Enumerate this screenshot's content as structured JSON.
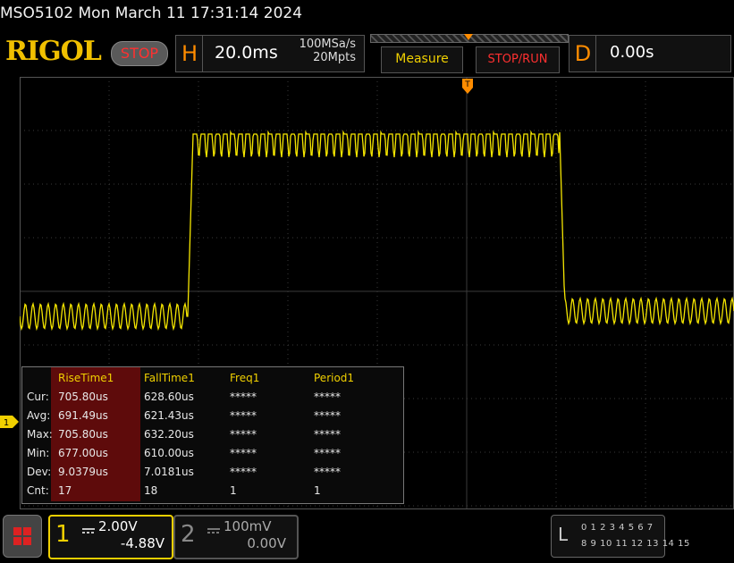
{
  "title": "MSO5102  Mon March 11 17:31:14 2024",
  "brand": "RIGOL",
  "run_state": "STOP",
  "horizontal": {
    "label": "H",
    "timebase": "20.0ms",
    "sample_rate": "100MSa/s",
    "memory_depth": "20Mpts"
  },
  "buttons": {
    "measure": "Measure",
    "stop_run": "STOP/RUN"
  },
  "delay": {
    "label": "D",
    "value": "0.00s"
  },
  "measurements": {
    "headers": [
      "RiseTime1",
      "FallTime1",
      "Freq1",
      "Period1"
    ],
    "rows": [
      {
        "label": "Cur:",
        "values": [
          "705.80us",
          "628.60us",
          "*****",
          "*****"
        ]
      },
      {
        "label": "Avg:",
        "values": [
          "691.49us",
          "621.43us",
          "*****",
          "*****"
        ]
      },
      {
        "label": "Max:",
        "values": [
          "705.80us",
          "632.20us",
          "*****",
          "*****"
        ]
      },
      {
        "label": "Min:",
        "values": [
          "677.00us",
          "610.00us",
          "*****",
          "*****"
        ]
      },
      {
        "label": "Dev:",
        "values": [
          "9.0379us",
          "7.0181us",
          "*****",
          "*****"
        ]
      },
      {
        "label": "Cnt:",
        "values": [
          "17",
          "18",
          "1",
          "1"
        ]
      }
    ]
  },
  "channel1": {
    "number": "1",
    "scale": "2.00V",
    "offset": "-4.88V",
    "color": "#f0d000"
  },
  "channel2": {
    "number": "2",
    "scale": "100mV",
    "offset": "0.00V",
    "color": "#888888"
  },
  "ch1_marker": "1",
  "logic": {
    "label": "L",
    "row1": "0 1 2 3  4 5 6 7",
    "row2": "8 9 10 11 12 13 14 15"
  },
  "colors": {
    "trace": "#f5e600",
    "accent": "#ff8c00",
    "grid": "#3a3a3a",
    "stop": "#ff3030"
  },
  "icons": {
    "menu": "grid-menu-icon",
    "trigger": "trigger-position-icon",
    "channel_marker": "channel-1-marker-icon",
    "coupling": "dc-coupling-icon"
  }
}
